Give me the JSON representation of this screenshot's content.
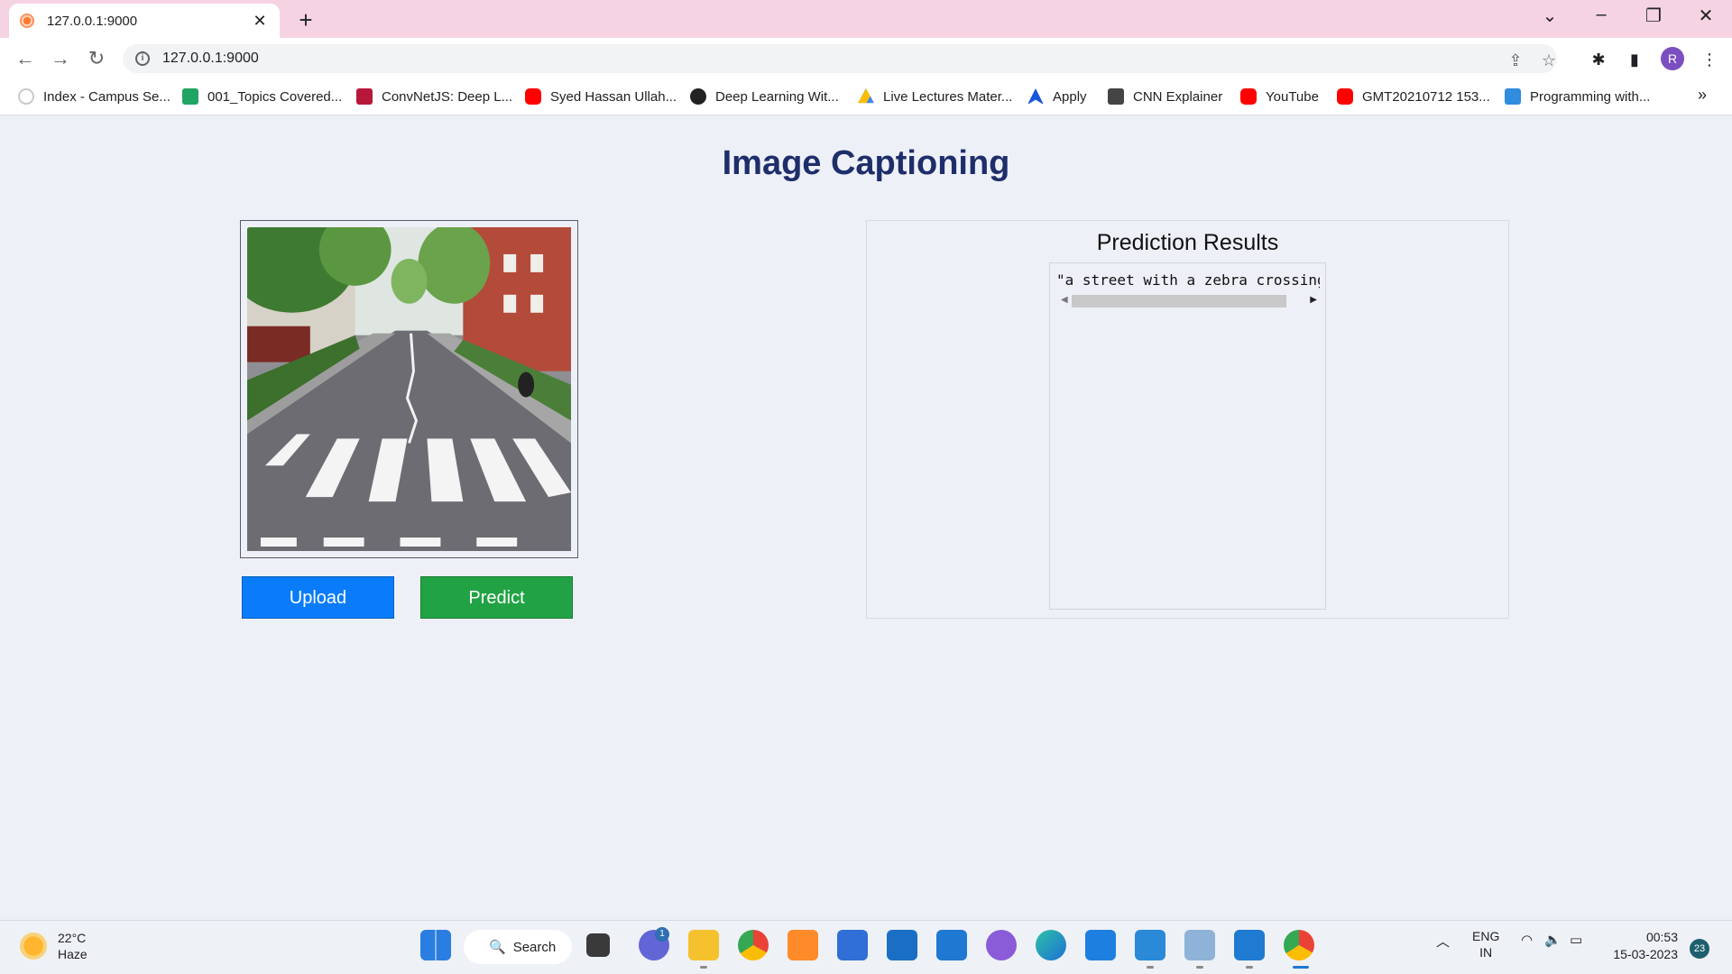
{
  "browser": {
    "tab_title": "127.0.0.1:9000",
    "tab_close": "✕",
    "new_tab": "+",
    "url": "127.0.0.1:9000",
    "bookmarks": [
      {
        "label": "Index - Campus Se...",
        "icon_color": "#c9c9c9"
      },
      {
        "label": "001_Topics Covered...",
        "icon_color": "#1fa463"
      },
      {
        "label": "ConvNetJS: Deep L...",
        "icon_color": "#b7183a"
      },
      {
        "label": "Syed Hassan Ullah...",
        "icon_color": "#ff0000"
      },
      {
        "label": "Deep Learning Wit...",
        "icon_color": "#222222"
      },
      {
        "label": "Live Lectures Mater...",
        "icon_color": "#fbbc04"
      },
      {
        "label": "Apply",
        "icon_color": "#1a56db"
      },
      {
        "label": "CNN Explainer",
        "icon_color": "#444444"
      },
      {
        "label": "YouTube",
        "icon_color": "#ff0000"
      },
      {
        "label": "GMT20210712 153...",
        "icon_color": "#ff0000"
      },
      {
        "label": "Programming with...",
        "icon_color": "#2f8cdf"
      }
    ],
    "profile_initial": "R",
    "more_bookmarks": "»"
  },
  "page": {
    "title": "Image Captioning",
    "upload_label": "Upload",
    "predict_label": "Predict",
    "results_title": "Prediction Results",
    "result_text": "\"a street with a zebra crossing\""
  },
  "taskbar": {
    "temperature": "22°C",
    "weather": "Haze",
    "search_label": "Search",
    "chat_badge": "1",
    "language_top": "ENG",
    "language_bottom": "IN",
    "time": "00:53",
    "date": "15-03-2023",
    "notification_count": "23"
  }
}
